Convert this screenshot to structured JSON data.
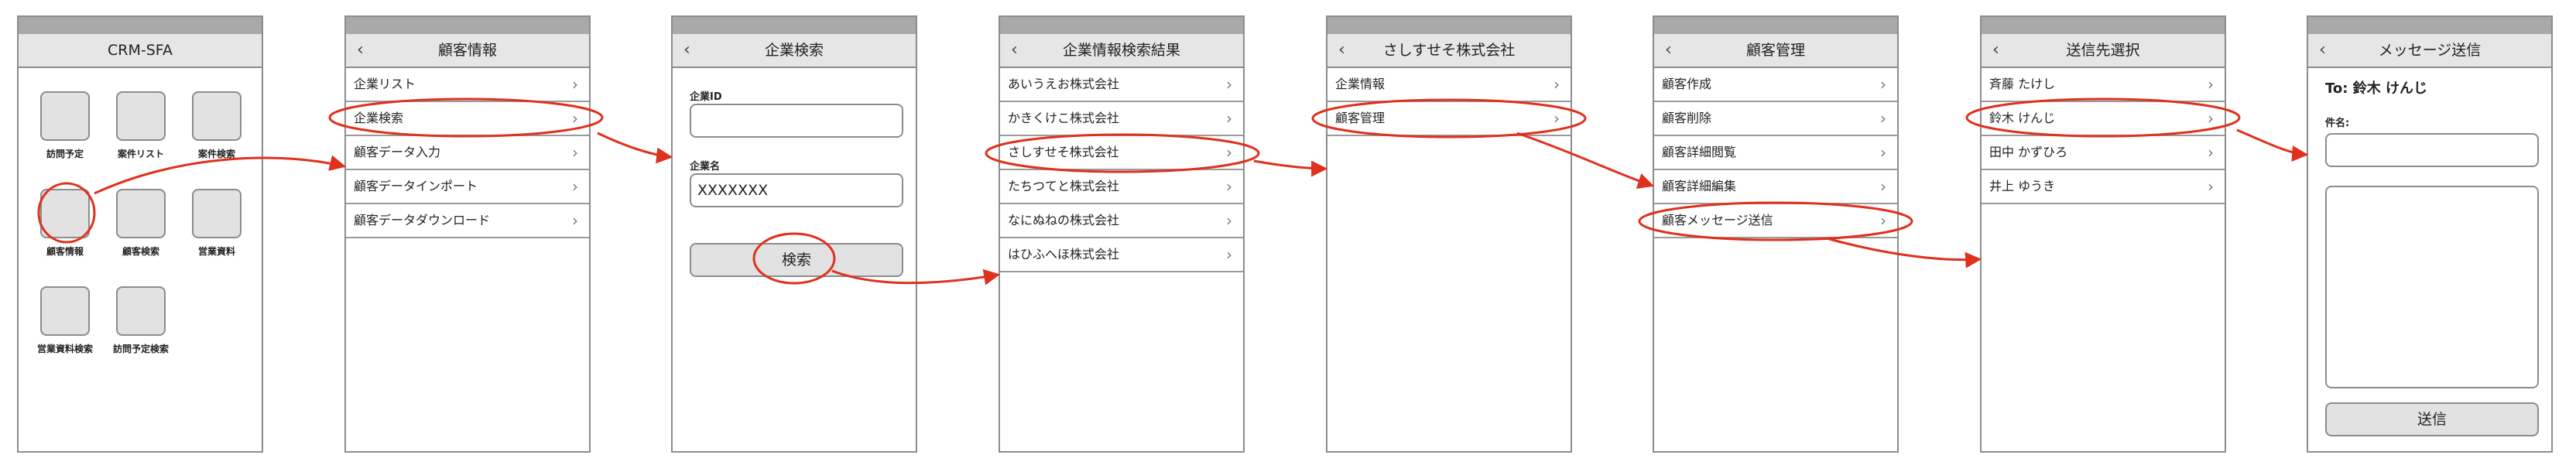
{
  "screens": {
    "home": {
      "title": "CRM-SFA",
      "icons": [
        "訪問予定",
        "案件リスト",
        "案件検索",
        "顧客情報",
        "顧客検索",
        "営業資料",
        "営業資料検索",
        "訪問予定検索"
      ]
    },
    "customer_info": {
      "title": "顧客情報",
      "items": [
        "企業リスト",
        "企業検索",
        "顧客データ入力",
        "顧客データインポート",
        "顧客データダウンロード"
      ]
    },
    "company_search": {
      "title": "企業検索",
      "id_label": "企業ID",
      "id_value": "",
      "name_label": "企業名",
      "name_value": "XXXXXXX",
      "search_button": "検索"
    },
    "search_results": {
      "title": "企業情報検索結果",
      "items": [
        "あいうえお株式会社",
        "かきくけこ株式会社",
        "さしすせそ株式会社",
        "たちつてと株式会社",
        "なにぬねの株式会社",
        "はひふへほ株式会社"
      ]
    },
    "company_detail": {
      "title": "さしすせそ株式会社",
      "items": [
        "企業情報",
        "顧客管理"
      ]
    },
    "customer_mgmt": {
      "title": "顧客管理",
      "items": [
        "顧客作成",
        "顧客削除",
        "顧客詳細閲覧",
        "顧客詳細編集",
        "顧客メッセージ送信"
      ]
    },
    "recipient": {
      "title": "送信先選択",
      "items": [
        "斉藤 たけし",
        "鈴木 けんじ",
        "田中 かずひろ",
        "井上 ゆうき"
      ]
    },
    "message": {
      "title": "メッセージ送信",
      "to_label": "To: 鈴木 けんじ",
      "subject_label": "件名:",
      "subject_value": "",
      "body_value": "",
      "send_button": "送信"
    }
  },
  "annotation_color": "#e0301e",
  "icons": {
    "back": "chevron-left-icon",
    "row": "chevron-right-icon"
  }
}
